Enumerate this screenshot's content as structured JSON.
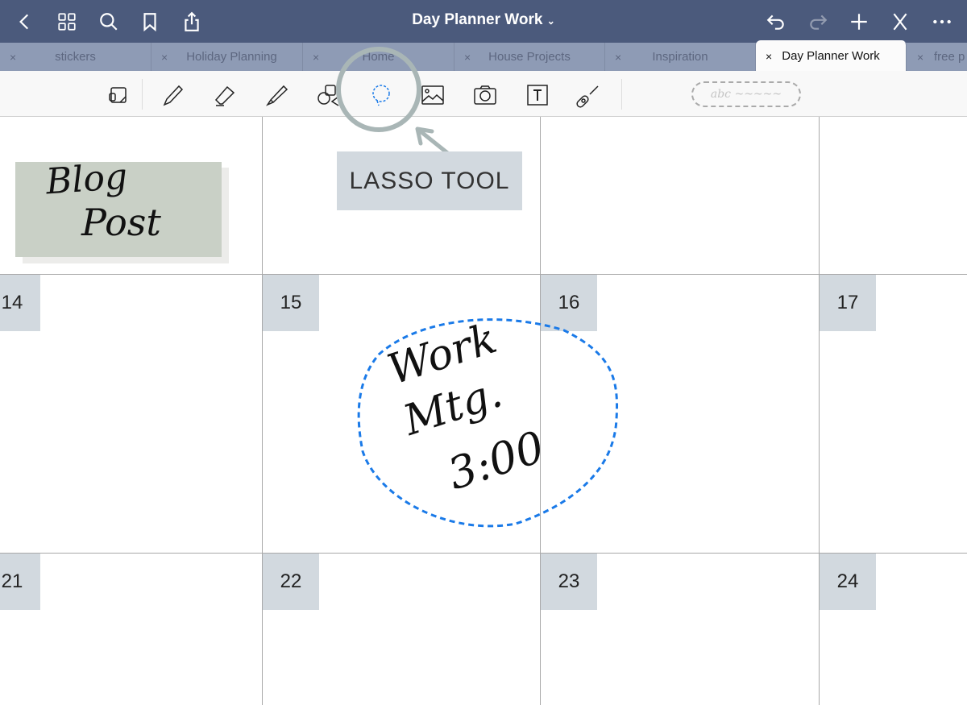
{
  "topbar": {
    "title": "Day Planner Work",
    "icons": [
      "chevron-left-icon",
      "grid-icon",
      "search-icon",
      "bookmark-icon",
      "share-icon",
      "undo-icon",
      "redo-icon",
      "plus-icon",
      "pen-off-icon",
      "more-icon"
    ]
  },
  "tabs": [
    {
      "label": "stickers",
      "active": false
    },
    {
      "label": "Holiday Planning",
      "active": false
    },
    {
      "label": "Home",
      "active": false
    },
    {
      "label": "House Projects",
      "active": false
    },
    {
      "label": "Inspiration",
      "active": false
    },
    {
      "label": "Day Planner Work",
      "active": true
    },
    {
      "label": "free p",
      "active": false
    }
  ],
  "tab_close": "×",
  "toolbar": {
    "tools": [
      "read-mode",
      "pen",
      "eraser",
      "highlighter",
      "shapes",
      "lasso",
      "image",
      "camera",
      "text",
      "laser-pointer"
    ],
    "active_tool": "lasso",
    "handwriting_placeholder": "abc ~~~~~",
    "accent": "#1a7ae8"
  },
  "calendar": {
    "days": [
      "14",
      "15",
      "16",
      "17",
      "21",
      "22",
      "23",
      "24"
    ],
    "sticker": {
      "line1": "Blog",
      "line2": "Post"
    },
    "note": {
      "line1": "Work",
      "line2": "Mtg.",
      "line3": "3:00"
    }
  },
  "callout": {
    "label": "LASSO TOOL"
  }
}
